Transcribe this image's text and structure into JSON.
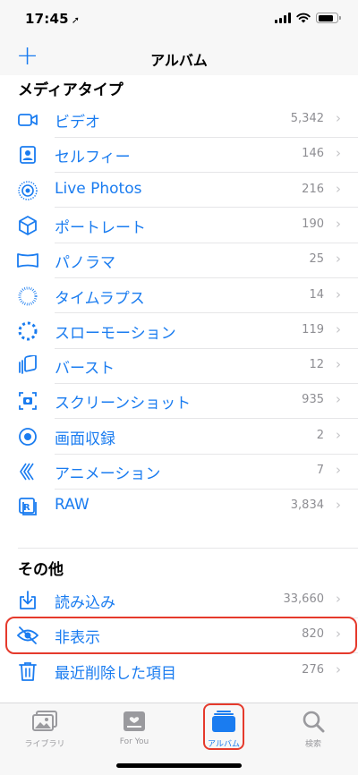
{
  "status": {
    "time": "17:45",
    "location_icon": "location-arrow-icon"
  },
  "nav": {
    "title": "アルバム",
    "add_label": "+"
  },
  "media_types": {
    "header": "メディアタイプ",
    "items": [
      {
        "label": "ビデオ",
        "count": "5,342",
        "icon": "video-icon"
      },
      {
        "label": "セルフィー",
        "count": "146",
        "icon": "selfie-icon"
      },
      {
        "label": "Live Photos",
        "count": "216",
        "icon": "live-photos-icon"
      },
      {
        "label": "ポートレート",
        "count": "190",
        "icon": "portrait-cube-icon"
      },
      {
        "label": "パノラマ",
        "count": "25",
        "icon": "panorama-icon"
      },
      {
        "label": "タイムラプス",
        "count": "14",
        "icon": "timelapse-icon"
      },
      {
        "label": "スローモーション",
        "count": "119",
        "icon": "slow-motion-icon"
      },
      {
        "label": "バースト",
        "count": "12",
        "icon": "burst-icon"
      },
      {
        "label": "スクリーンショット",
        "count": "935",
        "icon": "screenshot-icon"
      },
      {
        "label": "画面収録",
        "count": "2",
        "icon": "screen-recording-icon"
      },
      {
        "label": "アニメーション",
        "count": "7",
        "icon": "animation-icon"
      },
      {
        "label": "RAW",
        "count": "3,834",
        "icon": "raw-icon"
      }
    ]
  },
  "other": {
    "header": "その他",
    "items": [
      {
        "label": "読み込み",
        "count": "33,660",
        "icon": "import-icon"
      },
      {
        "label": "非表示",
        "count": "820",
        "icon": "hidden-eye-icon"
      },
      {
        "label": "最近削除した項目",
        "count": "276",
        "icon": "trash-icon"
      }
    ]
  },
  "tabs": [
    {
      "label": "ライブラリ",
      "icon": "library-photo-icon",
      "active": false
    },
    {
      "label": "For You",
      "icon": "for-you-icon",
      "active": false
    },
    {
      "label": "アルバム",
      "icon": "albums-icon",
      "active": true
    },
    {
      "label": "検索",
      "icon": "search-icon",
      "active": false
    }
  ],
  "colors": {
    "accent": "#1a7cf0",
    "highlight": "#e53a2c",
    "secondary_text": "#8e8e93"
  }
}
